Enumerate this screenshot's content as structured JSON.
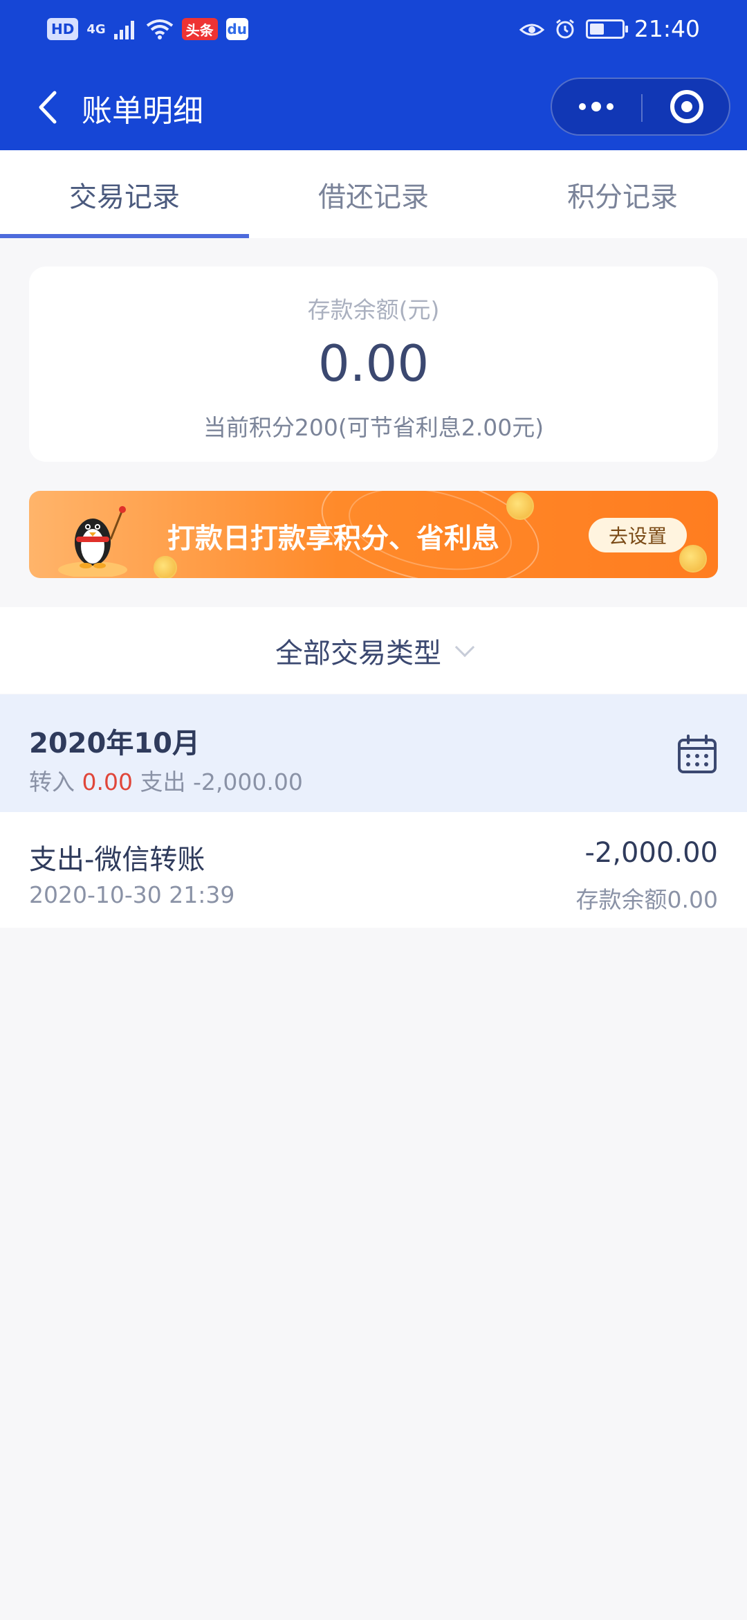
{
  "status_bar": {
    "hd": "HD",
    "network": "4G",
    "app1": "头条",
    "app2": "du",
    "time": "21:40"
  },
  "nav": {
    "title": "账单明细"
  },
  "tabs": [
    {
      "label": "交易记录",
      "active": true
    },
    {
      "label": "借还记录",
      "active": false
    },
    {
      "label": "积分记录",
      "active": false
    }
  ],
  "balance": {
    "label": "存款余额(元)",
    "value": "0.00",
    "points_info": "当前积分200(可节省利息2.00元)"
  },
  "banner": {
    "text": "打款日打款享积分、省利息",
    "button": "去设置"
  },
  "filter": {
    "label": "全部交易类型"
  },
  "month": {
    "title": "2020年10月",
    "in_label": "转入",
    "in_value": "0.00",
    "out_label": "支出",
    "out_value": "-2,000.00"
  },
  "transactions": [
    {
      "title": "支出-微信转账",
      "time": "2020-10-30 21:39",
      "amount": "-2,000.00",
      "balance": "存款余额0.00"
    }
  ],
  "colors": {
    "header": "#1646d6",
    "accent_underline": "#4d6bdc",
    "income": "#e0463a",
    "banner_orange": "#ff8a2a"
  }
}
